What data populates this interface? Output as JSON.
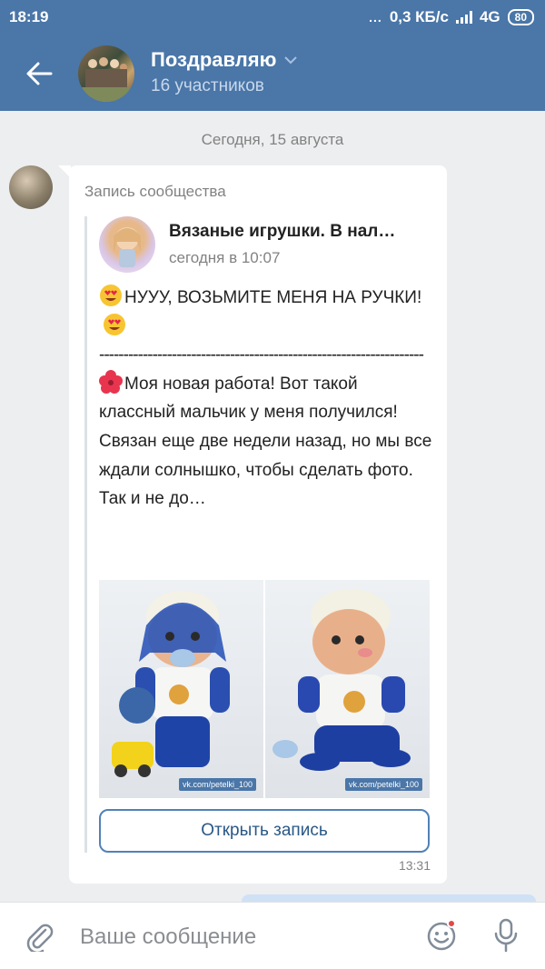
{
  "status_bar": {
    "time": "18:19",
    "dots": "...",
    "speed": "0,3 КБ/с",
    "network": "4G",
    "battery": "80"
  },
  "header": {
    "title": "Поздравляю",
    "subtitle": "16 участников",
    "icons": [
      "back-arrow-icon",
      "chevron-down-icon"
    ]
  },
  "chat": {
    "date_separator": "Сегодня, 15 августа",
    "message": {
      "repost_label": "Запись сообщества",
      "group_name": "Вязаные игрушки. В нал…",
      "post_time": "сегодня в 10:07",
      "text": {
        "line1": "НУУУ, ВОЗЬМИТЕ МЕНЯ НА РУЧКИ!",
        "dashes": "-------------------------------------------------------------------",
        "line2": "Моя новая работа! Вот такой классный мальчик у меня получился!",
        "line3": "Связан еще две недели назад, но мы все ждали солнышко, чтобы сделать фото. Так и не до…"
      },
      "photos": [
        {
          "watermark": "vk.com/petelki_100"
        },
        {
          "watermark": "vk.com/petelki_100"
        }
      ],
      "open_button": "Открыть запись",
      "time": "13:31"
    }
  },
  "composer": {
    "placeholder": "Ваше сообщение",
    "icons": [
      "paperclip-icon",
      "smile-icon",
      "microphone-icon"
    ]
  },
  "colors": {
    "header_bg": "#4a76a8",
    "chat_bg": "#edeef0",
    "link": "#2a5885",
    "button_border": "#5181b8",
    "notification_dot": "#e64646"
  }
}
